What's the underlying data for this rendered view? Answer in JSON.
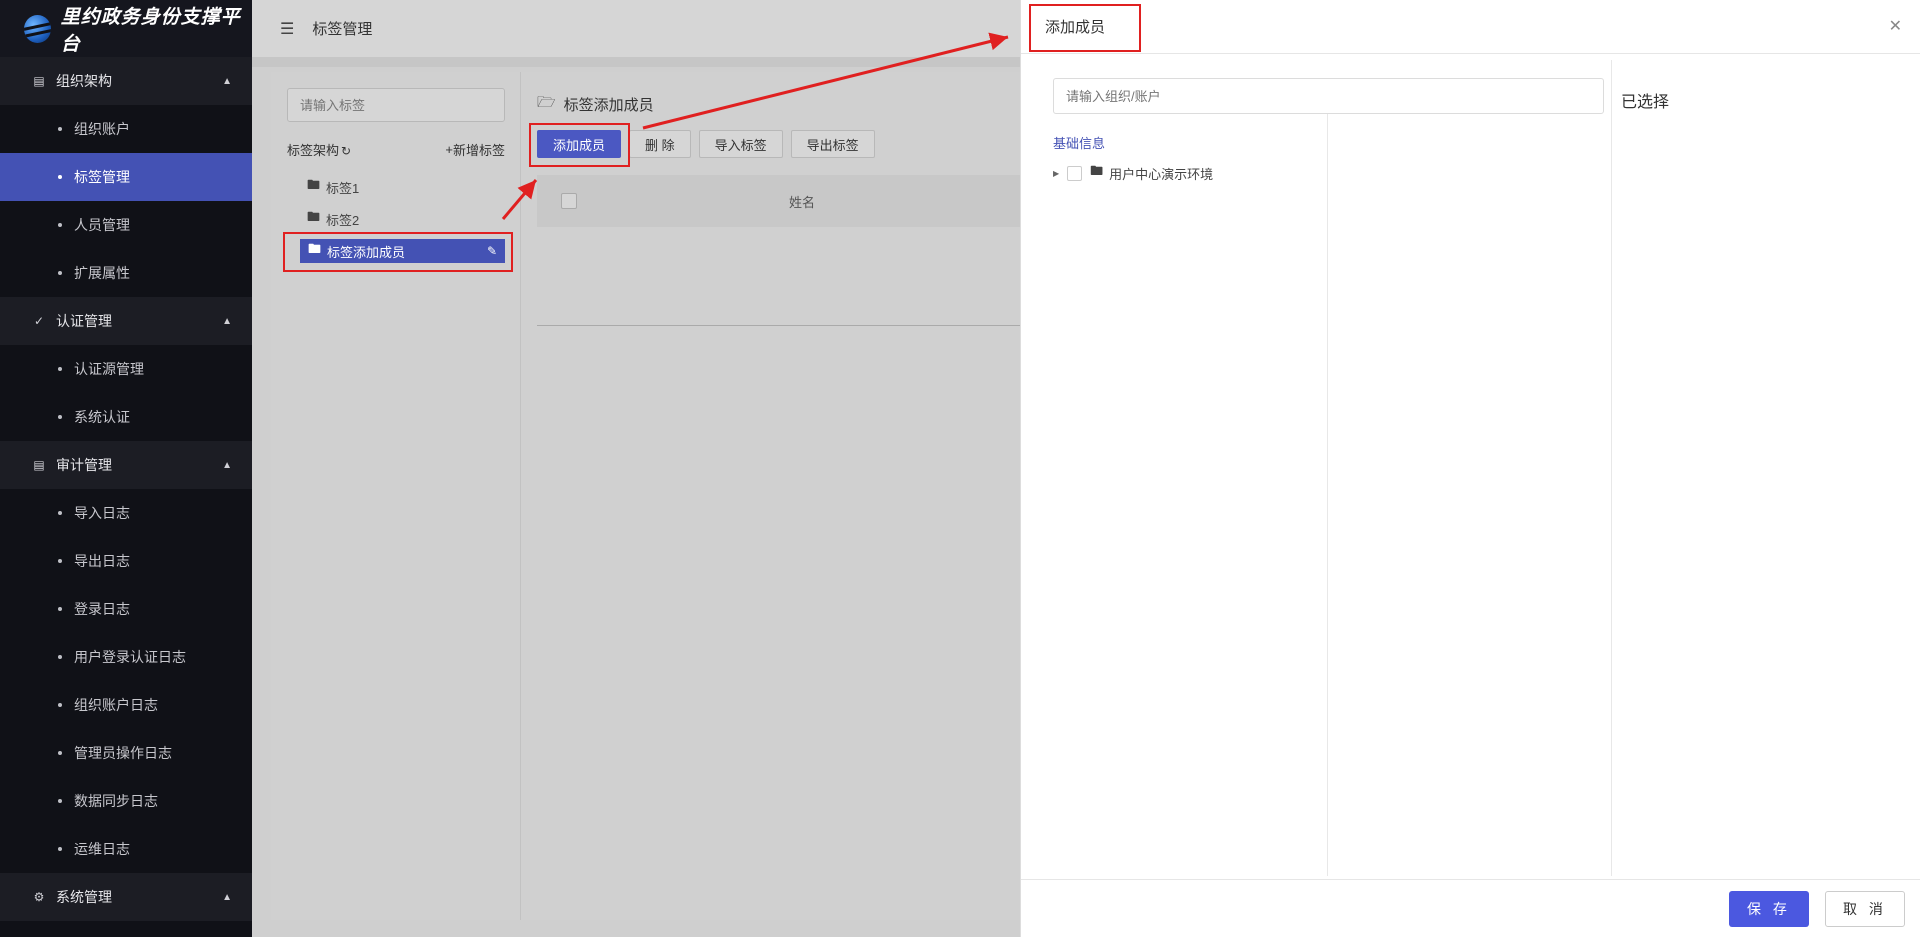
{
  "app": {
    "title": "里约政务身份支撑平台"
  },
  "sidebar": {
    "groups": [
      {
        "label": "组织架构",
        "icon": "list-icon",
        "items": [
          "组织账户",
          "标签管理",
          "人员管理",
          "扩展属性"
        ]
      },
      {
        "label": "认证管理",
        "icon": "check-circle-icon",
        "items": [
          "认证源管理",
          "系统认证"
        ]
      },
      {
        "label": "审计管理",
        "icon": "chart-icon",
        "items": [
          "导入日志",
          "导出日志",
          "登录日志",
          "用户登录认证日志",
          "组织账户日志",
          "管理员操作日志",
          "数据同步日志",
          "运维日志"
        ]
      },
      {
        "label": "系统管理",
        "icon": "gear-icon",
        "items": []
      }
    ],
    "active_item": "标签管理"
  },
  "header": {
    "breadcrumb": "标签管理"
  },
  "tag_panel": {
    "search_placeholder": "请输入标签",
    "tree_title": "标签架构",
    "add_label": "新增标签",
    "tags": [
      "标签1",
      "标签2",
      "标签添加成员"
    ],
    "selected_tag": "标签添加成员"
  },
  "main": {
    "title": "标签添加成员",
    "buttons": {
      "add_member": "添加成员",
      "delete": "删 除",
      "import": "导入标签",
      "export": "导出标签"
    },
    "table": {
      "columns": [
        "姓名"
      ]
    }
  },
  "drawer": {
    "title": "添加成员",
    "search_placeholder": "请输入组织/账户",
    "selected_title": "已选择",
    "section_label": "基础信息",
    "org_root": "用户中心演示环境",
    "save_label": "保 存",
    "cancel_label": "取 消"
  },
  "colors": {
    "accent": "#4452b4",
    "primary_button": "#4b58e0",
    "annotation": "#e02020",
    "sidebar_bg": "#101117"
  }
}
